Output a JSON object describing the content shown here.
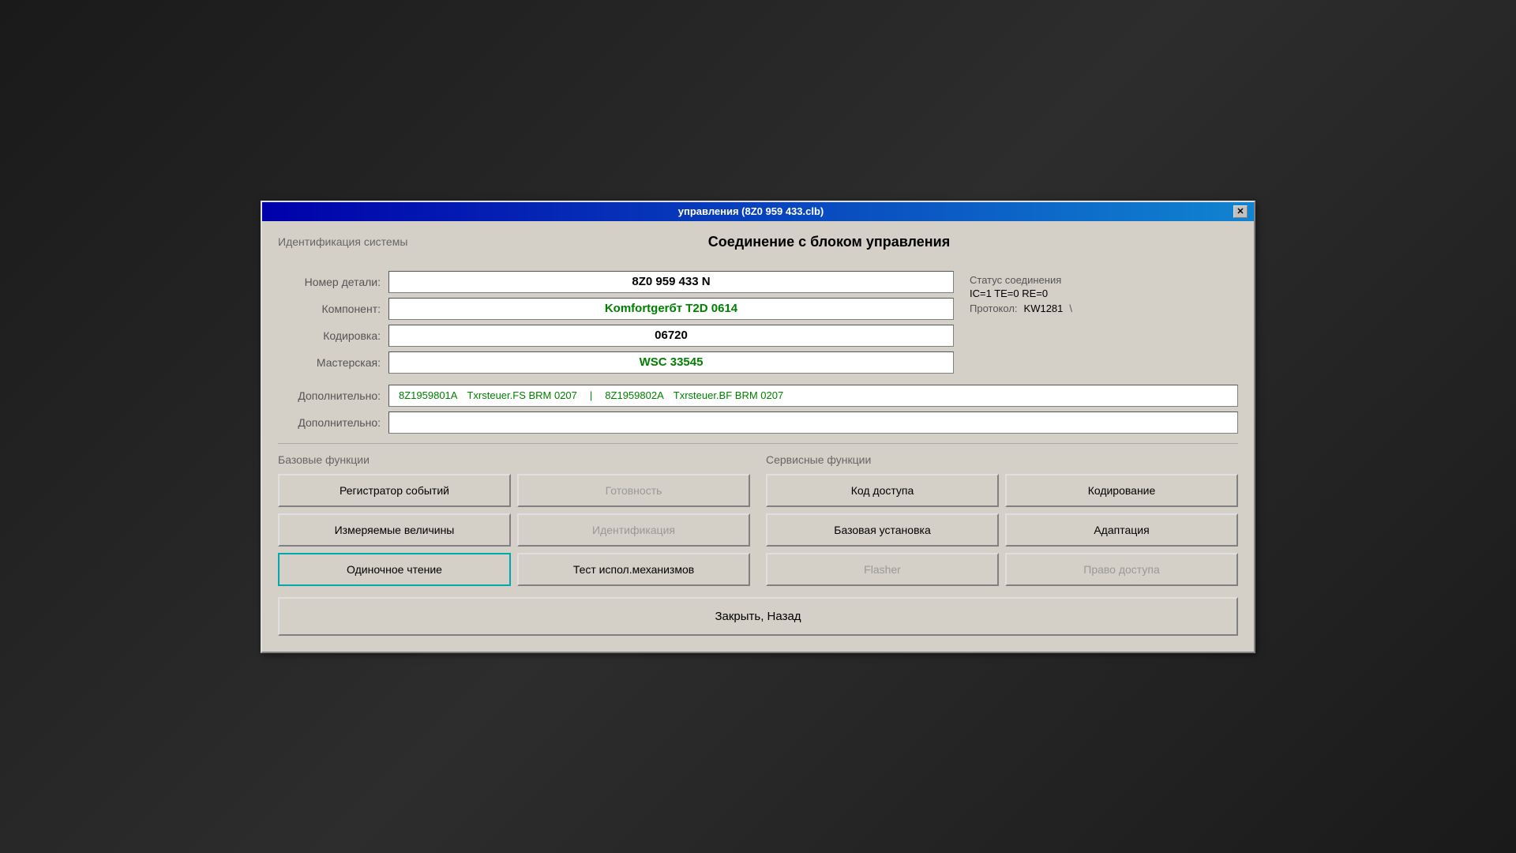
{
  "window": {
    "title": "управления (8Z0 959 433.clb)",
    "close_label": "✕"
  },
  "header": {
    "section_label": "Идентификация системы",
    "title": "Соединение с блоком управления"
  },
  "fields": {
    "part_number_label": "Номер детали:",
    "part_number_value": "8Z0 959 433 N",
    "component_label": "Компонент:",
    "component_value": "Komfortgerбт T2D   0614",
    "coding_label": "Кодировка:",
    "coding_value": "06720",
    "workshop_label": "Мастерская:",
    "workshop_value": "WSC 33545",
    "extra1_label": "Дополнительно:",
    "extra1_value1": "8Z1959801A",
    "extra1_sep1": "Txrsteuer.FS BRM 0207",
    "extra1_pipe": "|",
    "extra1_value2": "8Z1959802A",
    "extra1_sep2": "Txrsteuer.BF BRM 0207",
    "extra2_label": "Дополнительно:",
    "extra2_value": ""
  },
  "status": {
    "label": "Статус соединения",
    "values": "IC=1  TE=0  RE=0",
    "protocol_label": "Протокол:",
    "protocol_value": "KW1281",
    "protocol_suffix": "\\"
  },
  "basic_functions": {
    "title": "Базовые функции",
    "buttons": [
      {
        "label": "Регистратор событий",
        "disabled": false,
        "active": false
      },
      {
        "label": "Готовность",
        "disabled": true,
        "active": false
      },
      {
        "label": "Измеряемые величины",
        "disabled": false,
        "active": false
      },
      {
        "label": "Идентификация",
        "disabled": true,
        "active": false
      },
      {
        "label": "Одиночное чтение",
        "disabled": false,
        "active": true
      },
      {
        "label": "Тест испол.механизмов",
        "disabled": false,
        "active": false
      }
    ]
  },
  "service_functions": {
    "title": "Сервисные функции",
    "buttons": [
      {
        "label": "Код доступа",
        "disabled": false,
        "active": false
      },
      {
        "label": "Кодирование",
        "disabled": false,
        "active": false
      },
      {
        "label": "Базовая установка",
        "disabled": false,
        "active": false
      },
      {
        "label": "Адаптация",
        "disabled": false,
        "active": false
      },
      {
        "label": "Flasher",
        "disabled": true,
        "active": false
      },
      {
        "label": "Право доступа",
        "disabled": true,
        "active": false
      }
    ]
  },
  "footer": {
    "close_back_label": "Закрыть, Назад"
  }
}
